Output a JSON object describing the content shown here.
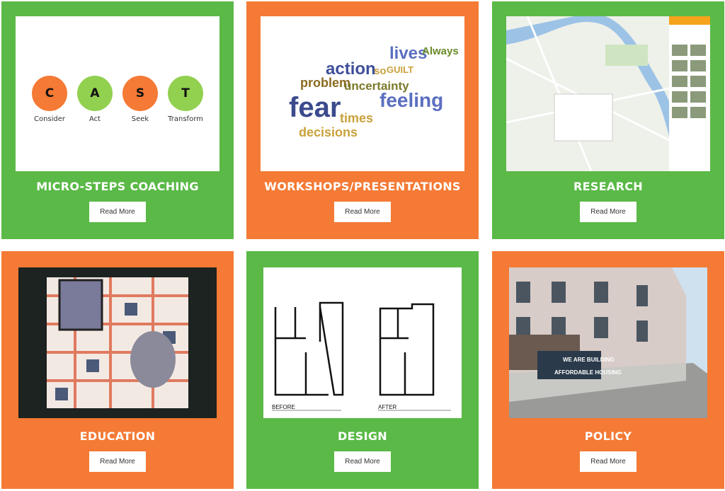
{
  "colors": {
    "green": "#5ab947",
    "orange": "#f47a35",
    "cast_orange": "#f47a35",
    "cast_green": "#92d050"
  },
  "cards": [
    {
      "title": "MICRO-STEPS COACHING",
      "button": "Read More",
      "color": "green",
      "cast": [
        {
          "letter": "C",
          "label": "Consider"
        },
        {
          "letter": "A",
          "label": "Act"
        },
        {
          "letter": "S",
          "label": "Seek"
        },
        {
          "letter": "T",
          "label": "Transform"
        }
      ]
    },
    {
      "title": "WORKSHOPS/PRESENTATIONS",
      "button": "Read More",
      "color": "orange",
      "words": [
        "fear",
        "feeling",
        "action",
        "lives",
        "problem",
        "uncertainty",
        "decisions",
        "times",
        "Always",
        "GUILT",
        "so"
      ]
    },
    {
      "title": "RESEARCH",
      "button": "Read More",
      "color": "green"
    },
    {
      "title": "EDUCATION",
      "button": "Read More",
      "color": "orange"
    },
    {
      "title": "DESIGN",
      "button": "Read More",
      "color": "green",
      "plans": [
        "BEFORE",
        "AFTER"
      ]
    },
    {
      "title": "POLICY",
      "button": "Read More",
      "color": "orange",
      "banner": [
        "WE ARE BUILDING",
        "AFFORDABLE HOUSING"
      ]
    }
  ]
}
